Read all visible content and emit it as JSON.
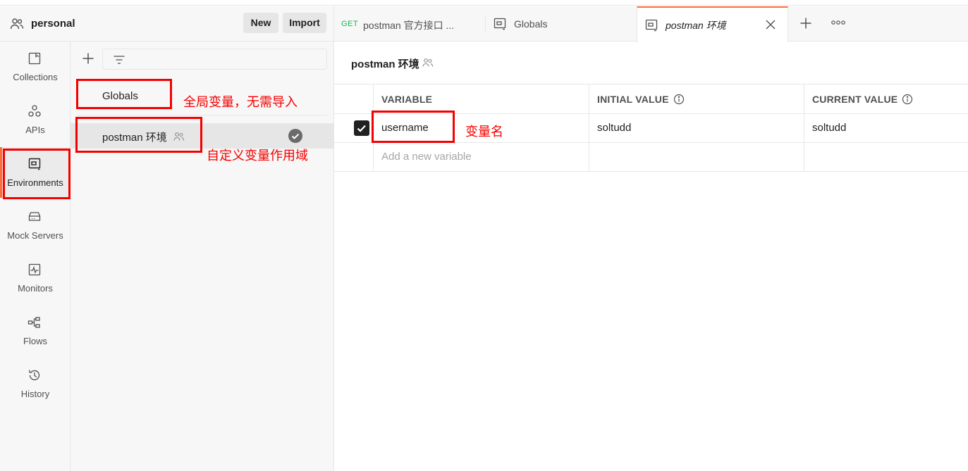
{
  "workspace": {
    "name": "personal",
    "new_label": "New",
    "import_label": "Import"
  },
  "sidebar": {
    "items": [
      {
        "label": "Collections",
        "icon": "collections-icon"
      },
      {
        "label": "APIs",
        "icon": "apis-icon"
      },
      {
        "label": "Environments",
        "icon": "environments-icon",
        "active": true
      },
      {
        "label": "Mock Servers",
        "icon": "mock-servers-icon"
      },
      {
        "label": "Monitors",
        "icon": "monitors-icon"
      },
      {
        "label": "Flows",
        "icon": "flows-icon"
      },
      {
        "label": "History",
        "icon": "history-icon"
      }
    ]
  },
  "env_list": {
    "items": [
      {
        "name": "Globals"
      },
      {
        "name": "postman 环境",
        "active": true
      }
    ]
  },
  "tabs": [
    {
      "method": "GET",
      "title": "postman 官方接口 ..."
    },
    {
      "title": "Globals"
    },
    {
      "title": "postman 环境",
      "active": true
    }
  ],
  "main": {
    "title": "postman 环境",
    "columns": [
      "VARIABLE",
      "INITIAL VALUE",
      "CURRENT VALUE"
    ],
    "rows": [
      {
        "enabled": true,
        "variable": "username",
        "initial": "soltudd",
        "current": "soltudd"
      }
    ],
    "new_variable_placeholder": "Add a new variable"
  },
  "annotations": {
    "globals_note": "全局变量，无需导入",
    "env_note": "自定义变量作用域",
    "variable_note": "变量名"
  },
  "colors": {
    "accent": "#ff6c37",
    "annotation": "#f50000",
    "get_method": "#0cbb52"
  }
}
